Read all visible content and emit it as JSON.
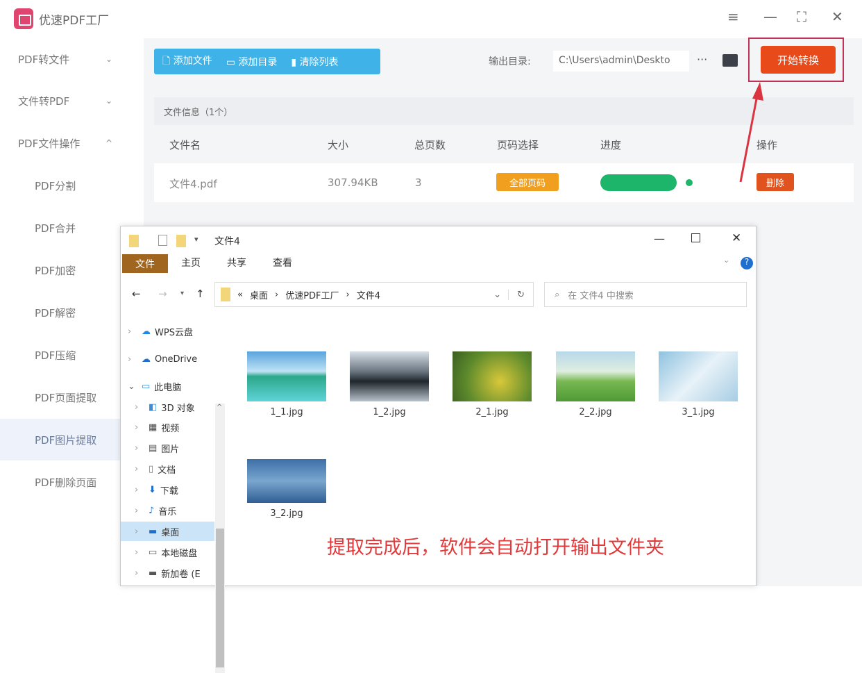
{
  "app": {
    "title": "优速PDF工厂",
    "window_controls": [
      "menu-icon",
      "minimize-icon",
      "maximize-icon",
      "close-icon"
    ]
  },
  "sidebar": {
    "items": [
      {
        "label": "PDF转文件",
        "chevron": "⌄"
      },
      {
        "label": "文件转PDF",
        "chevron": "⌄"
      },
      {
        "label": "PDF文件操作",
        "chevron": "^"
      }
    ],
    "subitems": [
      "PDF分割",
      "PDF合并",
      "PDF加密",
      "PDF解密",
      "PDF压缩",
      "PDF页面提取",
      "PDF图片提取",
      "PDF删除页面"
    ],
    "active": "PDF图片提取"
  },
  "toolbar": {
    "add_file": "添加文件",
    "add_dir": "添加目录",
    "clear_list": "清除列表",
    "output_label": "输出目录:",
    "output_path": "C:\\Users\\admin\\Deskto",
    "more": "···",
    "start": "开始转换"
  },
  "file_info": "文件信息（1个）",
  "table": {
    "headers": [
      "文件名",
      "大小",
      "总页数",
      "页码选择",
      "进度",
      "操作"
    ],
    "rows": [
      {
        "name": "文件4.pdf",
        "size": "307.94KB",
        "pages": "3",
        "page_select": "全部页码",
        "progress": 1.0,
        "action": "删除"
      }
    ]
  },
  "explorer": {
    "title": "文件4",
    "tabs": [
      "文件",
      "主页",
      "共享",
      "查看"
    ],
    "path": [
      "桌面",
      "优速PDF工厂",
      "文件4"
    ],
    "search_placeholder": "在 文件4 中搜索",
    "nav": [
      "WPS云盘",
      "OneDrive",
      "此电脑",
      "3D 对象",
      "视频",
      "图片",
      "文档",
      "下载",
      "音乐",
      "桌面",
      "本地磁盘",
      "新加卷 (E"
    ],
    "selected_nav": "桌面",
    "files": [
      "1_1.jpg",
      "1_2.jpg",
      "2_1.jpg",
      "2_2.jpg",
      "3_1.jpg",
      "3_2.jpg"
    ]
  },
  "annotation": "提取完成后，软件会自动打开输出文件夹",
  "colors": {
    "toolbar": "#3fb3e8",
    "start": "#e84a1a",
    "progress": "#1db56a",
    "tag": "#f0a01e",
    "delete": "#e0521e",
    "annotation": "#e23a3a"
  }
}
